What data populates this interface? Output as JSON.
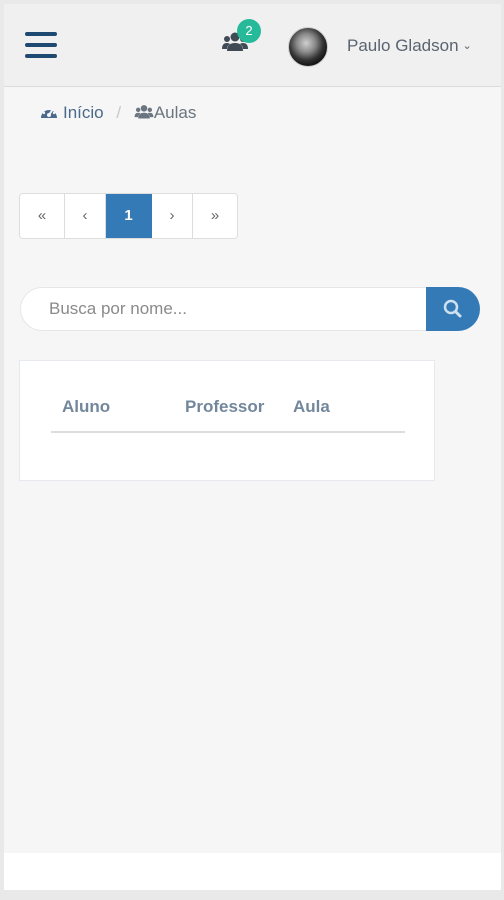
{
  "navbar": {
    "menu_icon": "hamburger-icon",
    "notifications": {
      "icon": "users-icon",
      "count": "2",
      "badge_color": "#26b99a"
    },
    "user": {
      "name": "Paulo Gladson",
      "caret": "⌄",
      "avatar": "user-avatar"
    }
  },
  "breadcrumb": {
    "home": {
      "icon": "dashboard-icon",
      "label": "Início"
    },
    "separator": "/",
    "current": {
      "icon": "users-icon",
      "label": "Aulas"
    }
  },
  "pagination": {
    "first": "«",
    "prev": "‹",
    "current": "1",
    "next": "›",
    "last": "»",
    "active_color": "#337ab7"
  },
  "search": {
    "placeholder": "Busca por nome...",
    "value": "",
    "button_icon": "search-icon"
  },
  "table": {
    "columns": [
      "Aluno",
      "Professor",
      "Aula"
    ],
    "rows": []
  },
  "colors": {
    "primary": "#337ab7",
    "nav_icon": "#1e4a72",
    "header_text": "#73879c"
  }
}
